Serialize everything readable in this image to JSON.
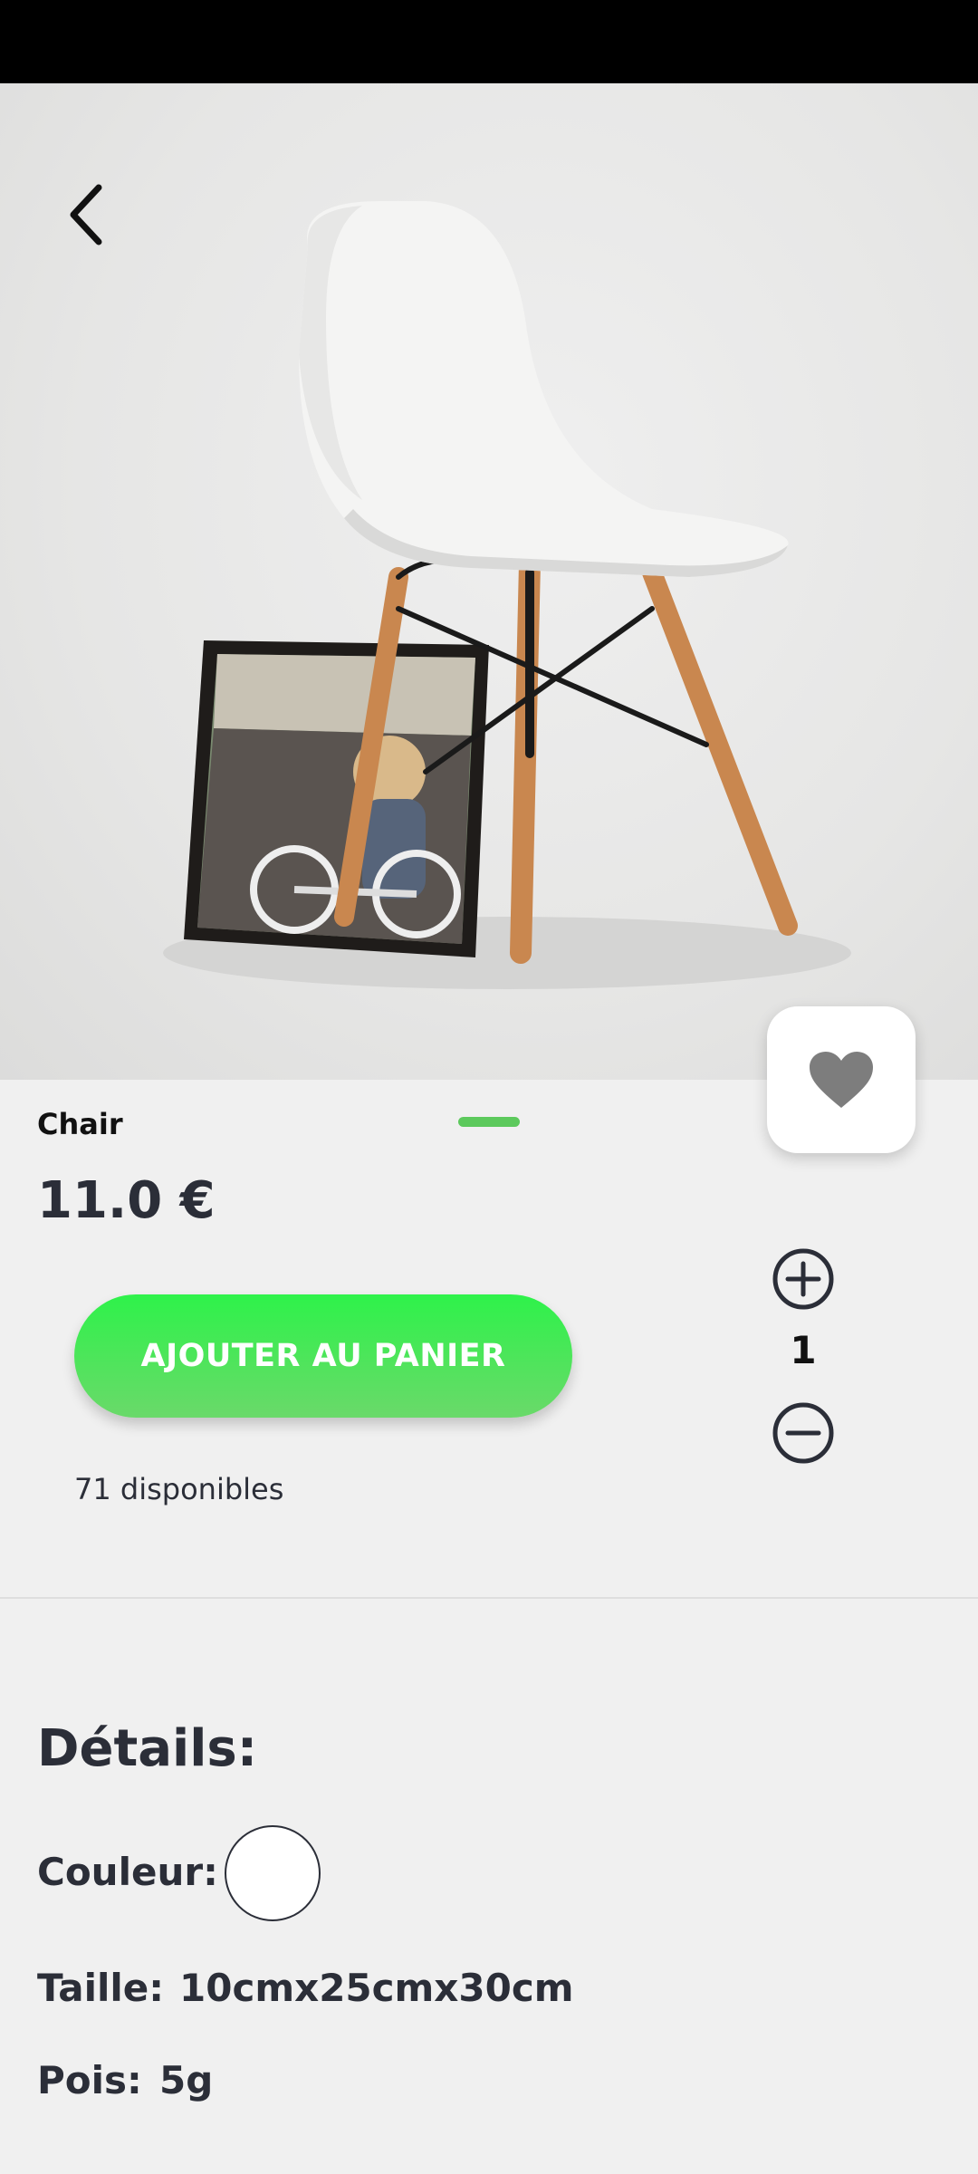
{
  "product": {
    "name": "Chair",
    "price": "11.0 €",
    "stock": "71 disponibles"
  },
  "actions": {
    "add_to_cart": "AJOUTER AU PANIER"
  },
  "quantity": {
    "value": "1"
  },
  "details": {
    "title": "Détails:",
    "color_label": "Couleur:",
    "color_value": "#ffffff",
    "size_label": "Taille:",
    "size_value": "10cmx25cmx30cm",
    "weight_label": "Pois:",
    "weight_value": "5g"
  },
  "icons": {
    "back": "back-arrow-icon",
    "favorite": "heart-icon",
    "increase": "plus-circle-icon",
    "decrease": "minus-circle-icon"
  },
  "colors": {
    "accent": "#2ef24a",
    "text": "#2b2e38"
  }
}
